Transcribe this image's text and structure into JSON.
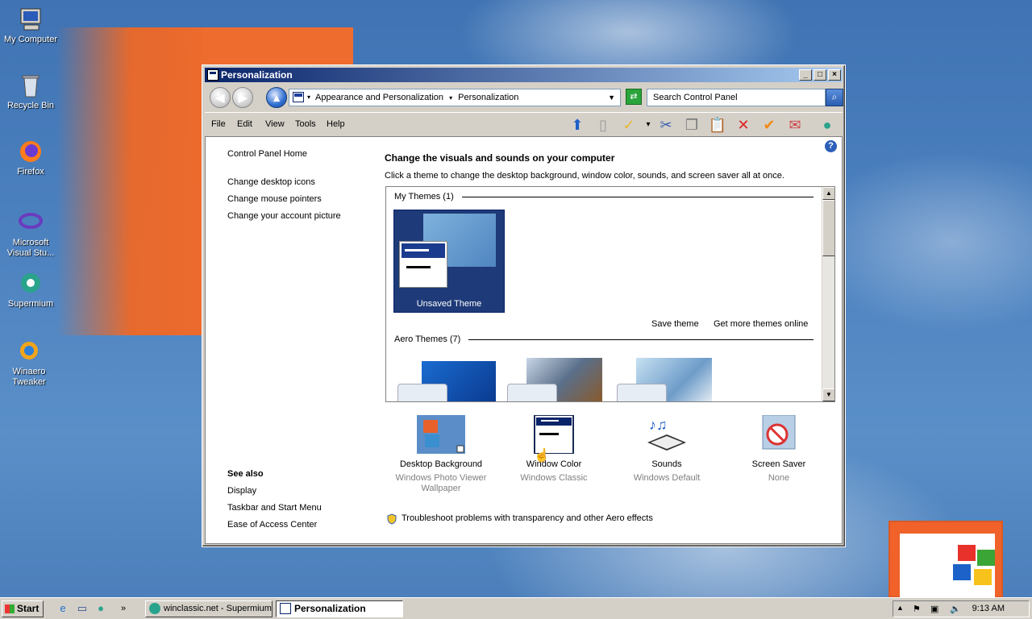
{
  "desktop": {
    "icons": [
      {
        "label": "My Computer"
      },
      {
        "label": "Recycle Bin"
      },
      {
        "label": "Firefox"
      },
      {
        "label": "Microsoft Visual Stu..."
      },
      {
        "label": "Supermium"
      },
      {
        "label": "Winaero Tweaker"
      }
    ]
  },
  "window": {
    "title": "Personalization",
    "breadcrumb": [
      "Appearance and Personalization",
      "Personalization"
    ],
    "search_placeholder": "Search Control Panel",
    "menu": [
      "File",
      "Edit",
      "View",
      "Tools",
      "Help"
    ],
    "sidebar": {
      "home": "Control Panel Home",
      "links": [
        "Change desktop icons",
        "Change mouse pointers",
        "Change your account picture"
      ],
      "see_also_title": "See also",
      "see_also": [
        "Display",
        "Taskbar and Start Menu",
        "Ease of Access Center"
      ]
    },
    "main": {
      "heading": "Change the visuals and sounds on your computer",
      "description": "Click a theme to change the desktop background, window color, sounds, and screen saver all at once.",
      "my_themes_label": "My Themes (1)",
      "unsaved_theme": "Unsaved Theme",
      "save_theme": "Save theme",
      "get_more": "Get more themes online",
      "aero_themes_label": "Aero Themes (7)",
      "options": [
        {
          "title": "Desktop Background",
          "sub": "Windows Photo Viewer Wallpaper"
        },
        {
          "title": "Window Color",
          "sub": "Windows Classic"
        },
        {
          "title": "Sounds",
          "sub": "Windows Default"
        },
        {
          "title": "Screen Saver",
          "sub": "None"
        }
      ],
      "troubleshoot": "Troubleshoot problems with transparency and other Aero effects"
    }
  },
  "taskbar": {
    "start": "Start",
    "tasks": [
      {
        "label": "winclassic.net - Supermium"
      },
      {
        "label": "Personalization"
      }
    ],
    "clock": "9:13 AM"
  },
  "colors": {
    "titlebar_start": "#0a246a",
    "titlebar_end": "#a6caf0",
    "chrome": "#d4d0c8",
    "desktop": "#4d82c0"
  }
}
